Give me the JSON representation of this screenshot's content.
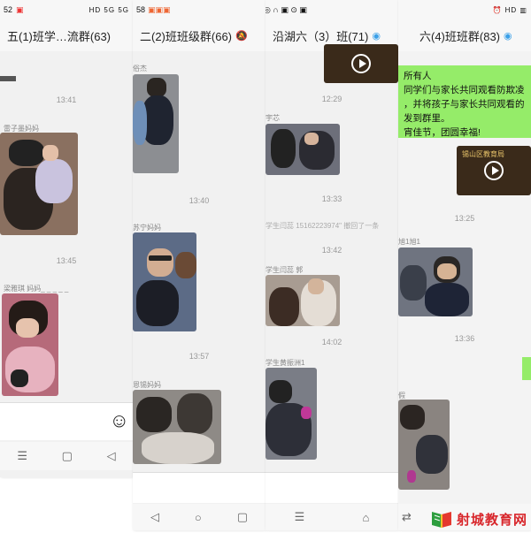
{
  "panel1": {
    "status_time": "52",
    "status_right": "HD 5G 5G",
    "title": "五(1)班学…流群(63)",
    "time1": "13:41",
    "sender1": "雷子墨妈妈",
    "time2": "13:45",
    "sender2": "梁雅琪 妈妈_ _ _ _ _",
    "emoji": "☺",
    "nav": [
      "☰",
      "▢",
      "◁"
    ]
  },
  "panel2": {
    "status_time": "58",
    "title": "二(2)班班级群(66)",
    "sender0": "俗杰",
    "time1": "13:40",
    "sender1": "苏宁妈妈",
    "time2": "13:57",
    "sender2": "恩锡妈妈",
    "nav": [
      "◁",
      "○",
      "▢"
    ]
  },
  "panel3": {
    "title": "沿湖六（3）班(71)",
    "time1": "12:29",
    "sender1": "宇芯",
    "time2": "13:33",
    "recall": "学生闫蕊 15162223974\" 撤回了一条",
    "time3": "13:42",
    "sender3": "学生闫蕊 郭",
    "time4": "14:02",
    "sender4": "学生黄振洲1",
    "nav": [
      "☰",
      "⌂"
    ]
  },
  "panel4": {
    "title": "六(4)班班群(83)",
    "msg_lines": [
      "所有人",
      "同学们与家长共同观看防欺凌",
      "，并将孩子与家长共同观看的",
      "发到群里。",
      "宵佳节，团圆幸福!"
    ],
    "video_caption": "锡山区教育局",
    "time1": "13:25",
    "sender1": "旭1旭1",
    "time2": "13:36",
    "sender2": "假",
    "nav": [
      "⇄"
    ]
  },
  "logo_text": "射城教育网",
  "colors": {
    "green_bubble": "#95ec69",
    "logo_red": "#d8262b",
    "accent_blue": "#3aa0e8"
  }
}
